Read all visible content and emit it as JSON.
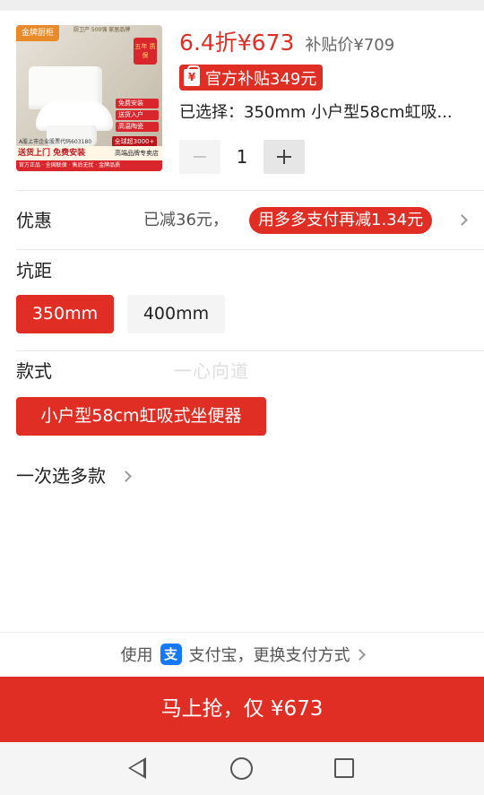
{
  "product": {
    "image": {
      "brand": "金牌厨柜",
      "topline": "厨卫产 500强 家居品牌",
      "badge": "五年 质保",
      "tags": [
        "免费安装",
        "送货入户",
        "高温陶瓷"
      ],
      "count": "全球超3000+",
      "stock_line": "A股上市企业股票代码603180",
      "bottom_left": "送货上门 免费安装",
      "bottom_right": "高端品牌专卖店",
      "footer": "官方正品 · 全国联保 · 售后无忧 · 金牌品质"
    },
    "price": "6.4折¥673",
    "original_price": "补贴价¥709",
    "subsidy_badge": "官方补贴349元",
    "subsidy_icon": "¥",
    "selected_label": "已选择：",
    "selected_value": "350mm 小户型58cm虹吸...",
    "quantity": "1"
  },
  "discount": {
    "label": "优惠",
    "reduced": "已减36元，",
    "pill": "用多多支付再减1.34元"
  },
  "pit_distance": {
    "title": "坑距",
    "options": [
      {
        "label": "350mm",
        "selected": true
      },
      {
        "label": "400mm",
        "selected": false
      }
    ]
  },
  "style": {
    "title": "款式",
    "options": [
      {
        "label": "小户型58cm虹吸式坐便器",
        "selected": true
      }
    ]
  },
  "watermark": "一心向道",
  "multi_select": "一次选多款",
  "payment": {
    "prefix": "使用",
    "method_icon": "支",
    "text": "支付宝，更换支付方式"
  },
  "buy_button": "马上抢，仅 ¥673",
  "colors": {
    "accent": "#e02e24",
    "alipay": "#1677ff"
  }
}
